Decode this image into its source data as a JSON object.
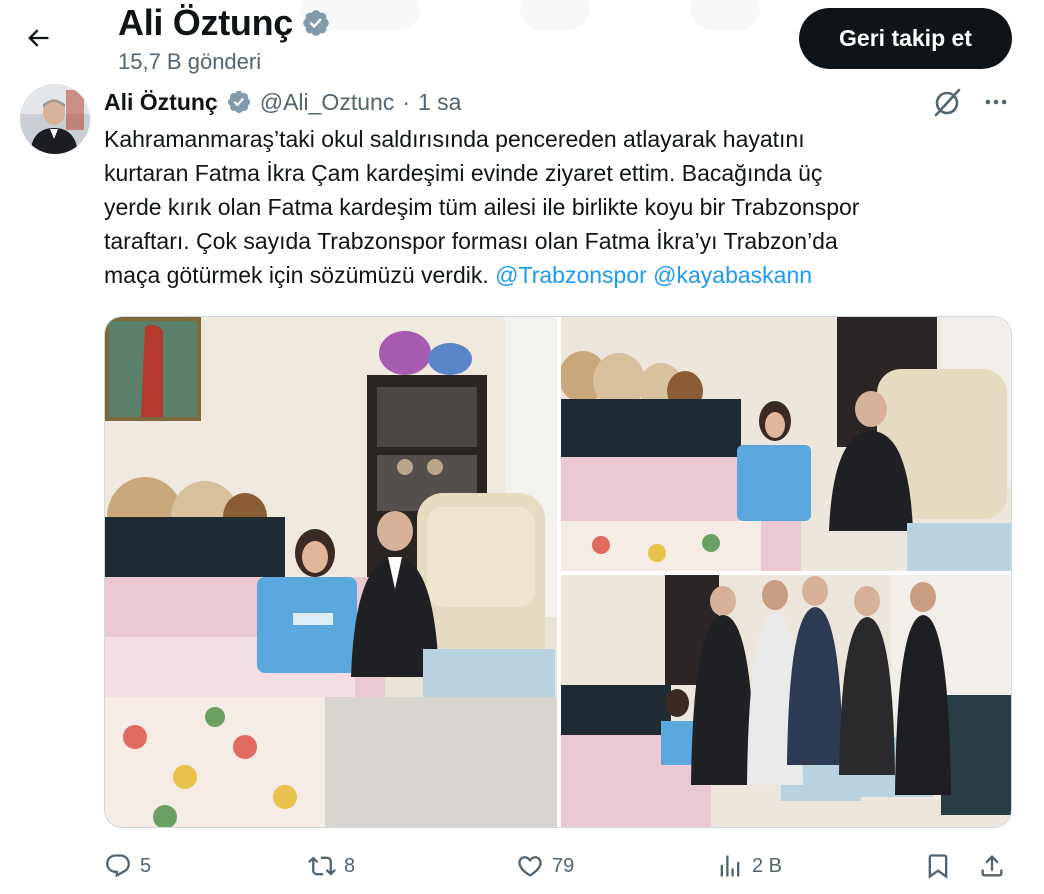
{
  "header": {
    "name": "Ali Öztunç",
    "post_count": "15,7 B gönderi",
    "follow_button": "Geri takip et",
    "back_icon": "arrow-left-icon",
    "verified_icon": "verified-badge-icon"
  },
  "tweet": {
    "author_name": "Ali Öztunç",
    "handle": "@Ali_Oztunc",
    "separator": "·",
    "time": "1 sa",
    "lines": [
      "Kahramanmaraş’taki okul saldırısında pencereden atlayarak hayatını",
      "kurtaran Fatma İkra Çam kardeşimi evinde ziyaret ettim. Bacağında üç",
      "yerde kırık olan Fatma kardeşim tüm ailesi ile birlikte koyu bir Trabzonspor",
      "taraftarı. Çok sayıda Trabzonspor forması olan Fatma İkra’yı Trabzon’da",
      "maça götürmek için sözümüzü verdik. "
    ],
    "mentions": [
      "@Trabzonspor",
      "@kayabaskann"
    ],
    "mention_separator": " ",
    "photos": [
      {
        "name": "photo-visit-1"
      },
      {
        "name": "photo-visit-2"
      },
      {
        "name": "photo-group"
      }
    ]
  },
  "actions": {
    "reply_count": "5",
    "repost_count": "8",
    "like_count": "79",
    "view_count": "2 B"
  },
  "colors": {
    "text": "#0f1419",
    "secondary": "#536471",
    "link": "#1d9bf0",
    "button_bg": "#0f1419",
    "verified": "#829aab"
  }
}
